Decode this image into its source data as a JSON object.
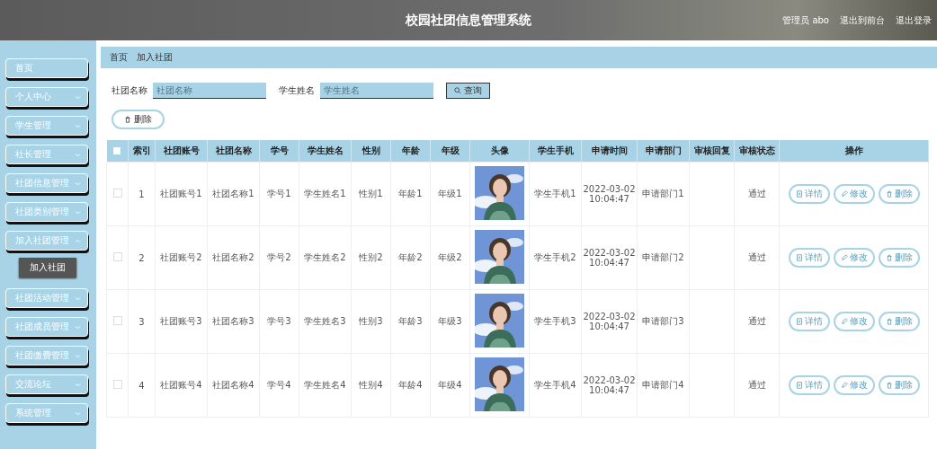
{
  "header": {
    "title": "校园社团信息管理系统",
    "user": "管理员 abo",
    "links": [
      "退出到前台",
      "退出登录"
    ]
  },
  "sidebar": {
    "items": [
      {
        "label": "首页"
      },
      {
        "label": "个人中心",
        "expanded": false
      },
      {
        "label": "学生管理",
        "expanded": false
      },
      {
        "label": "社长管理",
        "expanded": false
      },
      {
        "label": "社团信息管理",
        "expanded": false
      },
      {
        "label": "社团类别管理",
        "expanded": false
      },
      {
        "label": "加入社团管理",
        "expanded": true,
        "children": [
          {
            "label": "加入社团",
            "selected": true
          }
        ]
      },
      {
        "label": "社团活动管理",
        "expanded": false
      },
      {
        "label": "社团成员管理",
        "expanded": false
      },
      {
        "label": "社团缴费管理",
        "expanded": false
      },
      {
        "label": "交流论坛",
        "expanded": false
      },
      {
        "label": "系统管理",
        "expanded": false
      }
    ]
  },
  "breadcrumb": [
    "首页",
    "加入社团"
  ],
  "search": {
    "fields": [
      {
        "label": "社团名称",
        "placeholder": "社团名称"
      },
      {
        "label": "学生姓名",
        "placeholder": "学生姓名"
      }
    ],
    "button": "查询"
  },
  "delete_button": "删除",
  "table": {
    "header_checked": false,
    "columns": [
      "索引",
      "社团账号",
      "社团名称",
      "学号",
      "学生姓名",
      "性别",
      "年龄",
      "年级",
      "头像",
      "学生手机",
      "申请时间",
      "申请部门",
      "审核回复",
      "审核状态",
      "操作"
    ],
    "rows": [
      {
        "checked": false,
        "cells": [
          "1",
          "社团账号1",
          "社团名称1",
          "学号1",
          "学生姓名1",
          "性别1",
          "年龄1",
          "年级1"
        ],
        "avatar": {
          "kind": "picture"
        },
        "cells2": [
          "学生手机1",
          "2022-03-02 10:04:47",
          "申请部门1"
        ],
        "status": "通过",
        "actions": [
          "详情",
          "修改",
          "删除"
        ]
      },
      {
        "checked": false,
        "cells": [
          "2",
          "社团账号2",
          "社团名称2",
          "学号2",
          "学生姓名2",
          "性别2",
          "年龄2",
          "年级2"
        ],
        "avatar": {
          "kind": "picture"
        },
        "cells2": [
          "学生手机2",
          "2022-03-02 10:04:47",
          "申请部门2"
        ],
        "status": "通过",
        "actions": [
          "详情",
          "修改",
          "删除"
        ]
      },
      {
        "checked": false,
        "cells": [
          "3",
          "社团账号3",
          "社团名称3",
          "学号3",
          "学生姓名3",
          "性别3",
          "年龄3",
          "年级3"
        ],
        "avatar": {
          "kind": "picture"
        },
        "cells2": [
          "学生手机3",
          "2022-03-02 10:04:47",
          "申请部门3"
        ],
        "status": "通过",
        "actions": [
          "详情",
          "修改",
          "删除"
        ]
      },
      {
        "checked": false,
        "cells": [
          "4",
          "社团账号4",
          "社团名称4",
          "学号4",
          "学生姓名4",
          "性别4",
          "年龄4",
          "年级4"
        ],
        "avatar": {
          "kind": "picture"
        },
        "cells2": [
          "学生手机4",
          "2022-03-02 10:04:47",
          "申请部门4"
        ],
        "status": "通过",
        "actions": [
          "详情",
          "修改",
          "删除"
        ]
      }
    ]
  }
}
